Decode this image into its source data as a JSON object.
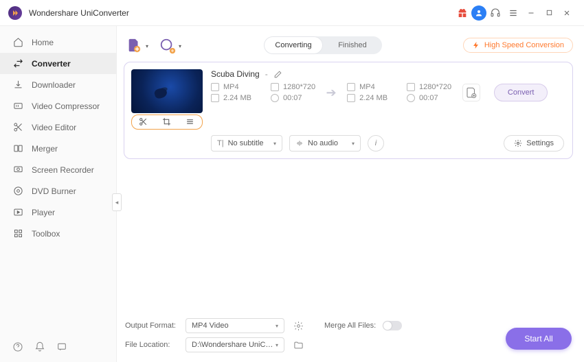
{
  "app": {
    "title": "Wondershare UniConverter"
  },
  "sidebar": {
    "items": [
      {
        "label": "Home"
      },
      {
        "label": "Converter"
      },
      {
        "label": "Downloader"
      },
      {
        "label": "Video Compressor"
      },
      {
        "label": "Video Editor"
      },
      {
        "label": "Merger"
      },
      {
        "label": "Screen Recorder"
      },
      {
        "label": "DVD Burner"
      },
      {
        "label": "Player"
      },
      {
        "label": "Toolbox"
      }
    ]
  },
  "toolbar": {
    "seg": {
      "converting": "Converting",
      "finished": "Finished"
    },
    "highspeed": "High Speed Conversion"
  },
  "file": {
    "name": "Scuba Diving",
    "sep": "-",
    "src": {
      "format": "MP4",
      "resolution": "1280*720",
      "size": "2.24 MB",
      "duration": "00:07"
    },
    "dst": {
      "format": "MP4",
      "resolution": "1280*720",
      "size": "2.24 MB",
      "duration": "00:07"
    },
    "convert": "Convert",
    "subtitle": "No subtitle",
    "audio": "No audio",
    "settings": "Settings"
  },
  "footer": {
    "outputFormatLabel": "Output Format:",
    "outputFormat": "MP4 Video",
    "fileLocationLabel": "File Location:",
    "fileLocation": "D:\\Wondershare UniConverter",
    "mergeLabel": "Merge All Files:",
    "startAll": "Start All"
  }
}
